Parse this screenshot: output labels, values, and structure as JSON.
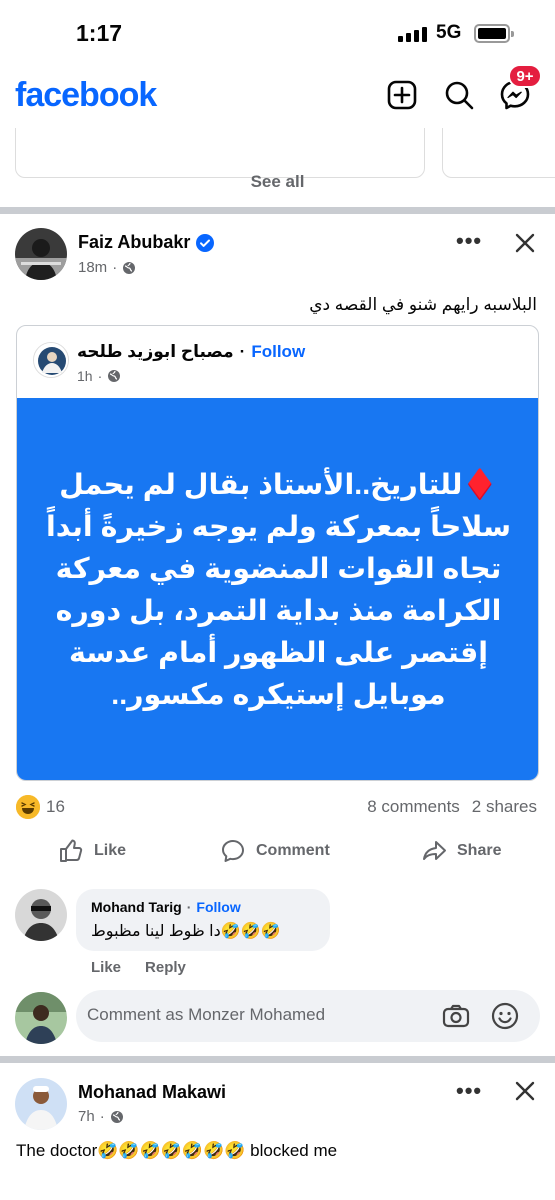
{
  "status_bar": {
    "time": "1:17",
    "network": "5G"
  },
  "header": {
    "logo": "facebook",
    "messenger_badge": "9+"
  },
  "suggestions": {
    "see_all": "See all"
  },
  "post": {
    "author": "Faiz Abubakr",
    "time": "18m",
    "text": "البلاسبه رايهم شنو في القصه دي",
    "shared": {
      "page_name": "مصباح ابوزيد طلحه",
      "separator": "·",
      "follow": "Follow",
      "time": "1h",
      "body": "♦️للتاريخ..الأستاذ بقال لم يحمل سلاحاً بمعركة ولم يوجه زخيرةً أبداً تجاه القوات المنضوية في معركة الكرامة منذ بداية التمرد، بل دوره إقتصر على الظهور أمام عدسة موبايل إستيكره مكسور.."
    },
    "reaction_count": "16",
    "comments_count": "8 comments",
    "shares_count": "2 shares",
    "actions": {
      "like": "Like",
      "comment": "Comment",
      "share": "Share"
    },
    "comment": {
      "author": "Mohand Tarig",
      "separator": "·",
      "follow": "Follow",
      "text": "دا ظوط لينا مظبوط🤣🤣🤣",
      "like": "Like",
      "reply": "Reply"
    },
    "comment_input_placeholder": "Comment as Monzer Mohamed"
  },
  "post2": {
    "author": "Mohanad Makawi",
    "time": "7h",
    "text": "The doctor🤣🤣🤣🤣🤣🤣🤣 blocked me"
  },
  "colors": {
    "brand": "#0866ff",
    "post_bg": "#1877f2",
    "badge": "#e41e3f"
  }
}
